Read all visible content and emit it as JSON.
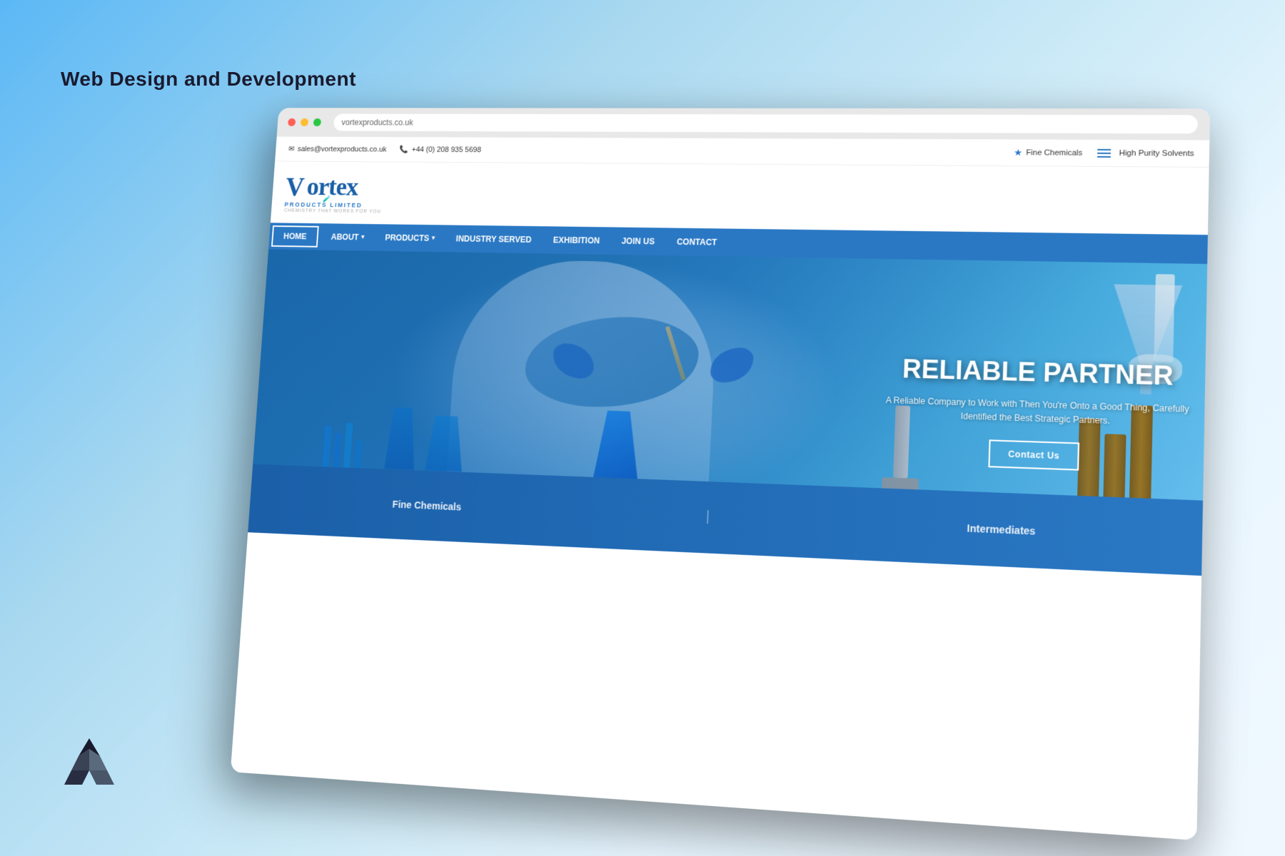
{
  "page": {
    "bg_label": "Web Design and Development"
  },
  "browser": {
    "address": "vortexproducts.co.uk"
  },
  "topbar": {
    "email": "sales@vortexproducts.co.uk",
    "phone": "+44 (0) 208 935 5698",
    "fine_chemicals": "Fine Chemicals",
    "high_purity": "High Purity Solvents"
  },
  "logo": {
    "main": "Vortex",
    "sub": "PRODUCTS LIMITED",
    "tagline": "CHEMISTRY THAT WORKS FOR YOU"
  },
  "nav": {
    "items": [
      {
        "label": "HOME",
        "active": true
      },
      {
        "label": "ABOUT",
        "has_dropdown": true
      },
      {
        "label": "PRODUCTS",
        "has_dropdown": true
      },
      {
        "label": "INDUSTRY SERVED"
      },
      {
        "label": "EXHIBITION"
      },
      {
        "label": "JOIN US"
      },
      {
        "label": "CONTACT"
      }
    ]
  },
  "hero": {
    "title": "RELIABLE PARTNER",
    "subtitle_line1": "A Reliable Company to Work with Then You're Onto a Good Thing, Carefully",
    "subtitle_line2": "Identified the Best Strategic Partners.",
    "cta_label": "Contact Us"
  },
  "bottom_teaser": {
    "items": [
      "Fine Chemicals",
      "Intermediates"
    ]
  }
}
